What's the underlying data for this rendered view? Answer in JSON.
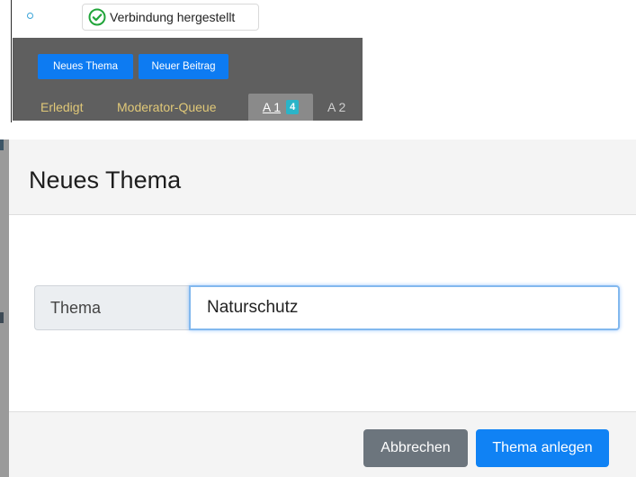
{
  "status": {
    "icon": "check-circle-icon",
    "text": "Verbindung hergestellt",
    "color": "#21a53a"
  },
  "toolbar": {
    "new_topic_label": "Neues Thema",
    "new_post_label": "Neuer Beitrag"
  },
  "tabs": [
    {
      "label": "Erledigt"
    },
    {
      "label": "Moderator-Queue"
    },
    {
      "label": "A 1",
      "badge": "4",
      "active": true
    },
    {
      "label": "A 2"
    }
  ],
  "modal": {
    "title": "Neues Thema",
    "field_label": "Thema",
    "field_value": "Naturschutz",
    "cancel_label": "Abbrechen",
    "submit_label": "Thema anlegen"
  },
  "colors": {
    "primary": "#1082f4",
    "secondary": "#6c757d",
    "toolbar_bg": "#5f5f5f",
    "tab_text": "#e0c878",
    "badge": "#2bb4c8"
  }
}
